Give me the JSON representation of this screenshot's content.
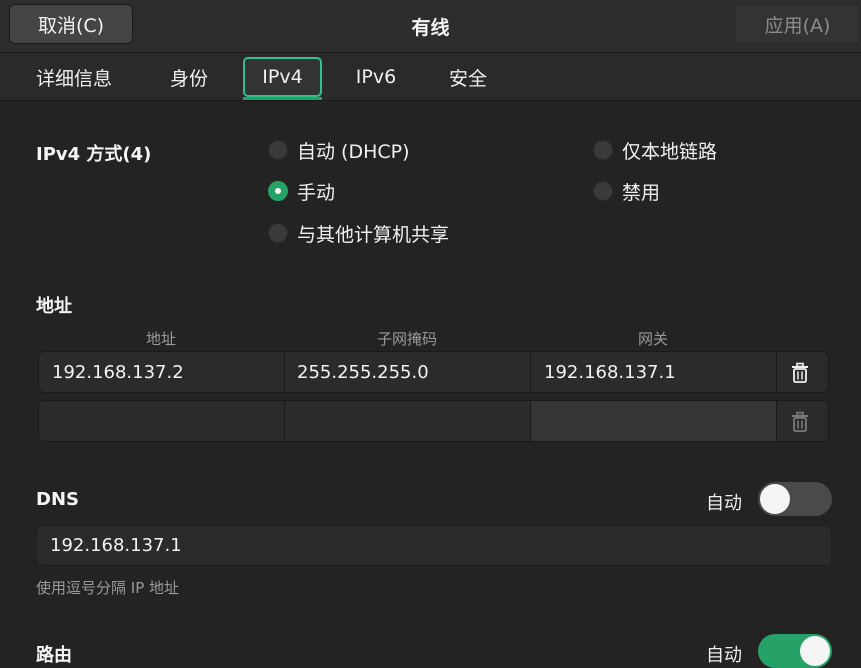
{
  "header": {
    "cancel_label": "取消(C)",
    "title": "有线",
    "apply_label": "应用(A)"
  },
  "tabs": [
    {
      "label": "详细信息",
      "active": false
    },
    {
      "label": "身份",
      "active": false
    },
    {
      "label": "IPv4",
      "active": true
    },
    {
      "label": "IPv6",
      "active": false
    },
    {
      "label": "安全",
      "active": false
    }
  ],
  "method": {
    "label": "IPv4 方式(4)",
    "options": [
      {
        "label": "自动 (DHCP)",
        "selected": false
      },
      {
        "label": "仅本地链路",
        "selected": false
      },
      {
        "label": "手动",
        "selected": true
      },
      {
        "label": "禁用",
        "selected": false
      },
      {
        "label": "与其他计算机共享",
        "selected": false
      }
    ]
  },
  "addresses": {
    "label": "地址",
    "columns": [
      "地址",
      "子网掩码",
      "网关"
    ],
    "rows": [
      {
        "address": "192.168.137.2",
        "netmask": "255.255.255.0",
        "gateway": "192.168.137.1"
      },
      {
        "address": "",
        "netmask": "",
        "gateway": ""
      }
    ]
  },
  "dns": {
    "label": "DNS",
    "auto_label": "自动",
    "auto_on": false,
    "value": "192.168.137.1",
    "hint": "使用逗号分隔 IP 地址"
  },
  "routes": {
    "label": "路由",
    "auto_label": "自动",
    "auto_on": true
  },
  "colors": {
    "accent": "#26a269",
    "focus": "#2ec28b",
    "background": "#232323"
  }
}
